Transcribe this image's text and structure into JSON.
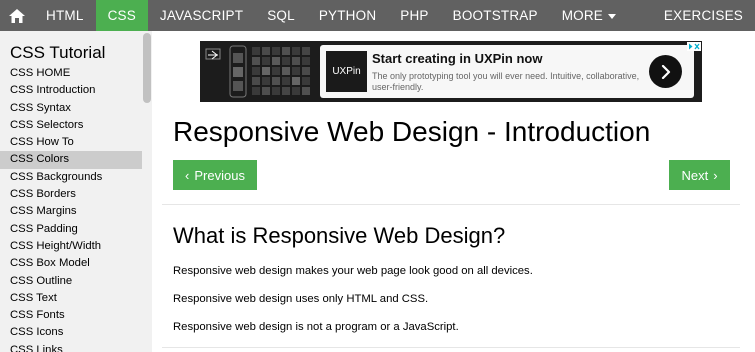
{
  "nav": {
    "items": [
      {
        "label": "HTML"
      },
      {
        "label": "CSS"
      },
      {
        "label": "JAVASCRIPT"
      },
      {
        "label": "SQL"
      },
      {
        "label": "PYTHON"
      },
      {
        "label": "PHP"
      },
      {
        "label": "BOOTSTRAP"
      },
      {
        "label": "MORE"
      }
    ],
    "active": "CSS",
    "exercises": "EXERCISES",
    "home_icon": "home-icon",
    "colors": {
      "bar": "#616161",
      "active": "#4CAF50"
    }
  },
  "sidebar": {
    "title": "CSS Tutorial",
    "items": [
      {
        "label": "CSS HOME"
      },
      {
        "label": "CSS Introduction"
      },
      {
        "label": "CSS Syntax"
      },
      {
        "label": "CSS Selectors"
      },
      {
        "label": "CSS How To"
      },
      {
        "label": "CSS Colors"
      },
      {
        "label": "CSS Backgrounds"
      },
      {
        "label": "CSS Borders"
      },
      {
        "label": "CSS Margins"
      },
      {
        "label": "CSS Padding"
      },
      {
        "label": "CSS Height/Width"
      },
      {
        "label": "CSS Box Model"
      },
      {
        "label": "CSS Outline"
      },
      {
        "label": "CSS Text"
      },
      {
        "label": "CSS Fonts"
      },
      {
        "label": "CSS Icons"
      },
      {
        "label": "CSS Links"
      }
    ],
    "active": "CSS Colors"
  },
  "ad": {
    "logo": "UXPin",
    "headline": "Start creating in UXPin now",
    "body": "The only prototyping tool you will ever need. Intuitive, collaborative, user-friendly.",
    "cta_icon": "chevron-right-icon"
  },
  "main": {
    "title": "Responsive Web Design - Introduction",
    "prev_label": "Previous",
    "next_label": "Next",
    "section_title": "What is Responsive Web Design?",
    "paragraphs": [
      "Responsive web design makes your web page look good on all devices.",
      "Responsive web design uses only HTML and CSS.",
      "Responsive web design is not a program or a JavaScript."
    ],
    "button_color": "#4CAF50"
  }
}
